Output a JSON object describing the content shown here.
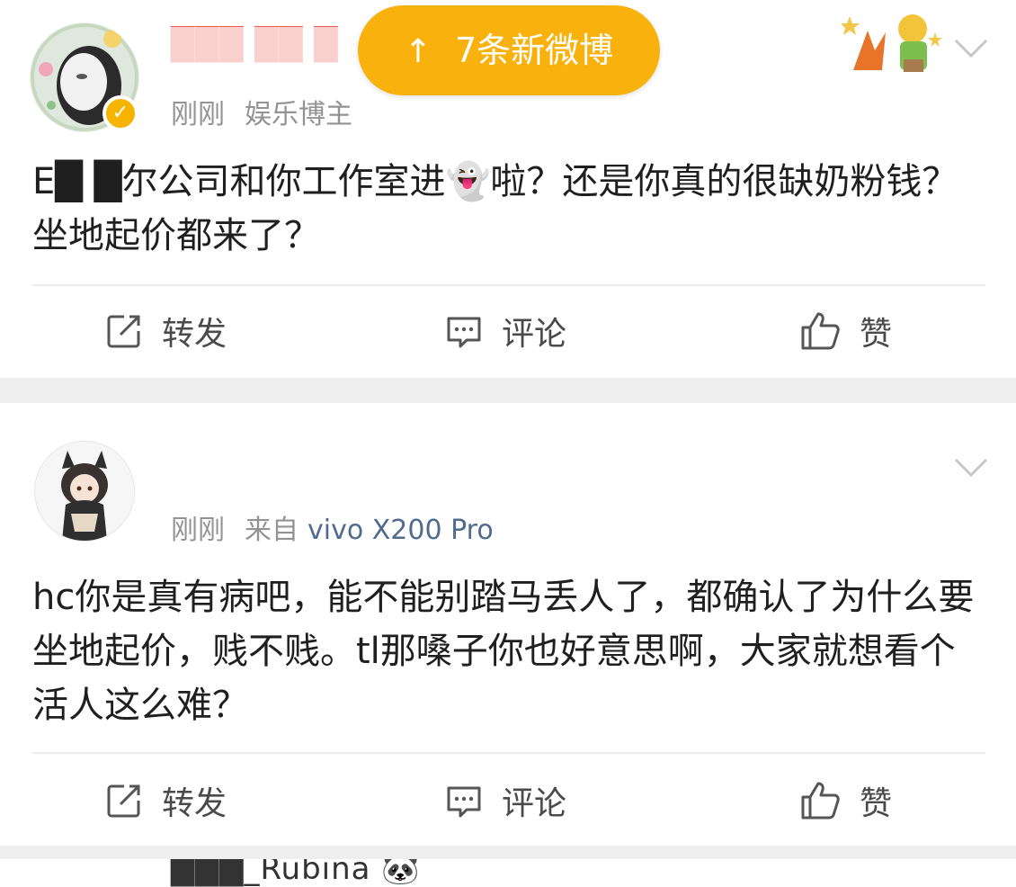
{
  "new_posts_button": {
    "label": "7条新微博"
  },
  "posts": [
    {
      "username": "███ ██ █",
      "time": "刚刚",
      "tag": "娱乐博主",
      "content": "E█ █尔公司和你工作室进👻啦？还是你真的很缺奶粉钱？坐地起价都来了？",
      "actions": {
        "repost": "转发",
        "comment": "评论",
        "like": "赞"
      }
    },
    {
      "username": "███_Rubina",
      "time": "刚刚",
      "source_prefix": "来自",
      "device": "vivo X200 Pro",
      "content": "hc你是真有病吧，能不能别踏马丢人了，都确认了为什么要坐地起价，贱不贱。tl那嗓子你也好意思啊，大家就想看个活人这么难？",
      "actions": {
        "repost": "转发",
        "comment": "评论",
        "like": "赞"
      }
    }
  ],
  "icons": [
    "up-arrow-icon",
    "chevron-down-icon",
    "verified-badge-icon",
    "repost-icon",
    "comment-icon",
    "like-icon",
    "panda-emoji-icon",
    "ghost-emoji-icon"
  ],
  "colors": {
    "accent": "#f9b20d",
    "meta_gray": "#939393",
    "device_blue": "#4f6b8e",
    "separator": "#eeeeee"
  }
}
